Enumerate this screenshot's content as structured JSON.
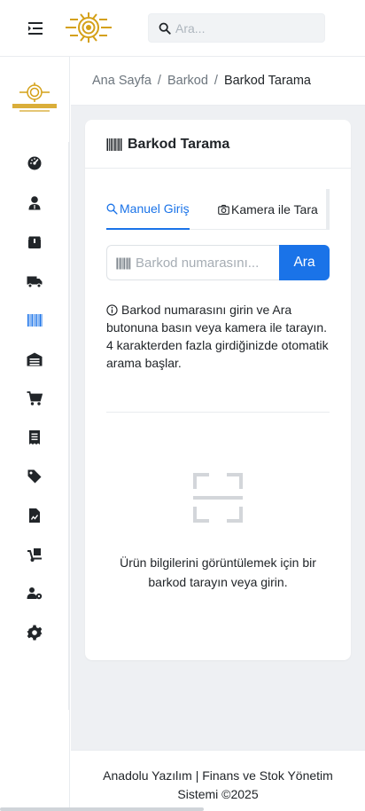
{
  "header": {
    "search_placeholder": "Ara..."
  },
  "breadcrumb": {
    "items": [
      "Ana Sayfa",
      "Barkod"
    ],
    "current": "Barkod Tarama",
    "separator": "/"
  },
  "card": {
    "title": "Barkod Tarama",
    "tabs": [
      {
        "label": "Manuel Giriş",
        "icon": "search-icon",
        "active": true
      },
      {
        "label": "Kamera ile Tara",
        "icon": "camera-icon",
        "active": false
      }
    ],
    "barcode_input_placeholder": "Barkod numarasını...",
    "search_button_label": "Ara",
    "info_text": "Barkod numarasını girin ve Ara butonuna basın veya kamera ile tarayın. 4 karakterden fazla girdiğinizde otomatik arama başlar.",
    "empty_state_text": "Ürün bilgilerini görüntülemek için bir barkod tarayın veya girin."
  },
  "sidebar": {
    "items": [
      {
        "icon": "dashboard-icon",
        "active": false
      },
      {
        "icon": "user-icon",
        "active": false
      },
      {
        "icon": "box-icon",
        "active": false
      },
      {
        "icon": "truck-icon",
        "active": false
      },
      {
        "icon": "barcode-icon",
        "active": true
      },
      {
        "icon": "warehouse-icon",
        "active": false
      },
      {
        "icon": "cart-icon",
        "active": false
      },
      {
        "icon": "receipt-icon",
        "active": false
      },
      {
        "icon": "tag-icon",
        "active": false
      },
      {
        "icon": "report-file-icon",
        "active": false
      },
      {
        "icon": "dolly-icon",
        "active": false
      },
      {
        "icon": "users-settings-icon",
        "active": false
      },
      {
        "icon": "gear-icon",
        "active": false
      }
    ]
  },
  "footer": {
    "text": "Anadolu Yazılım | Finans ve Stok Yönetim Sistemi ©2025"
  },
  "colors": {
    "accent": "#1a73e8",
    "background": "#eef0f3",
    "icon_dark": "#212529",
    "logo_gold": "#d4a017"
  }
}
